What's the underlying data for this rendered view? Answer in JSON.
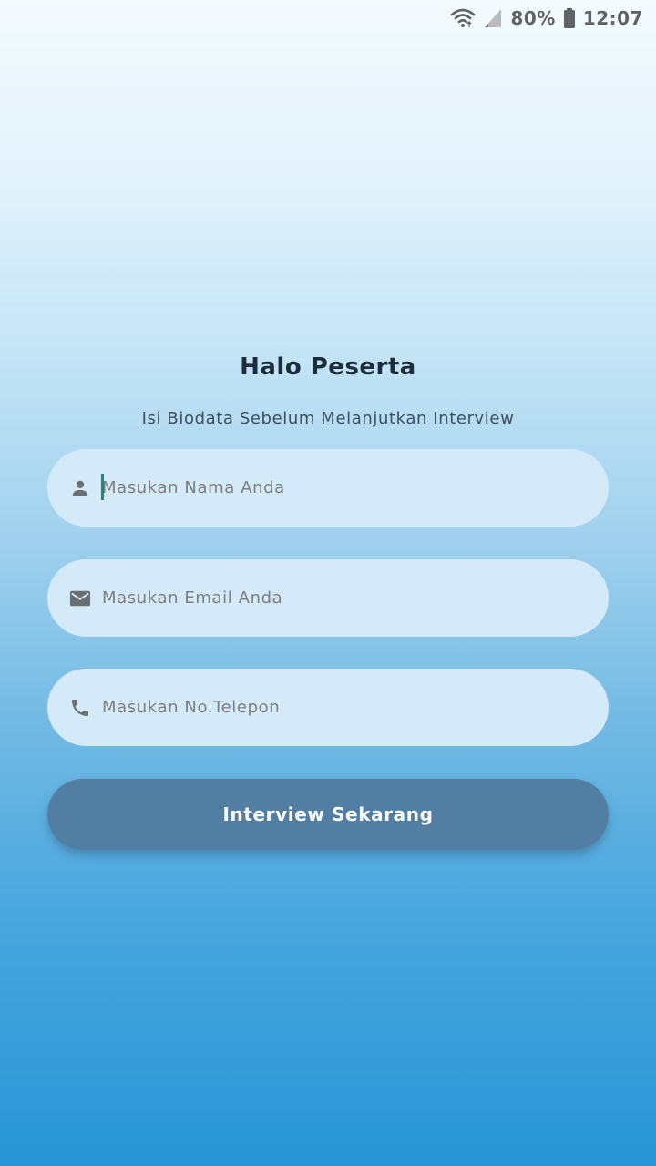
{
  "status_bar": {
    "battery_percent": "80%",
    "time": "12:07",
    "icons": [
      "wifi-icon",
      "cellular-signal-icon",
      "battery-icon"
    ]
  },
  "form": {
    "title": "Halo Peserta",
    "subtitle": "Isi Biodata Sebelum Melanjutkan Interview",
    "name_field": {
      "icon": "person-icon",
      "value": "",
      "placeholder": "Masukan Nama Anda"
    },
    "email_field": {
      "icon": "email-icon",
      "value": "",
      "placeholder": "Masukan Email Anda"
    },
    "phone_field": {
      "icon": "phone-icon",
      "value": "",
      "placeholder": "Masukan No.Telepon"
    },
    "submit_label": "Interview Sekarang"
  },
  "colors": {
    "button": "#527ea4",
    "field_background": "#d5eaf8",
    "cursor": "#1a8a7a",
    "gradient_top": "#f4fbfe",
    "gradient_bottom": "#2895d6"
  }
}
